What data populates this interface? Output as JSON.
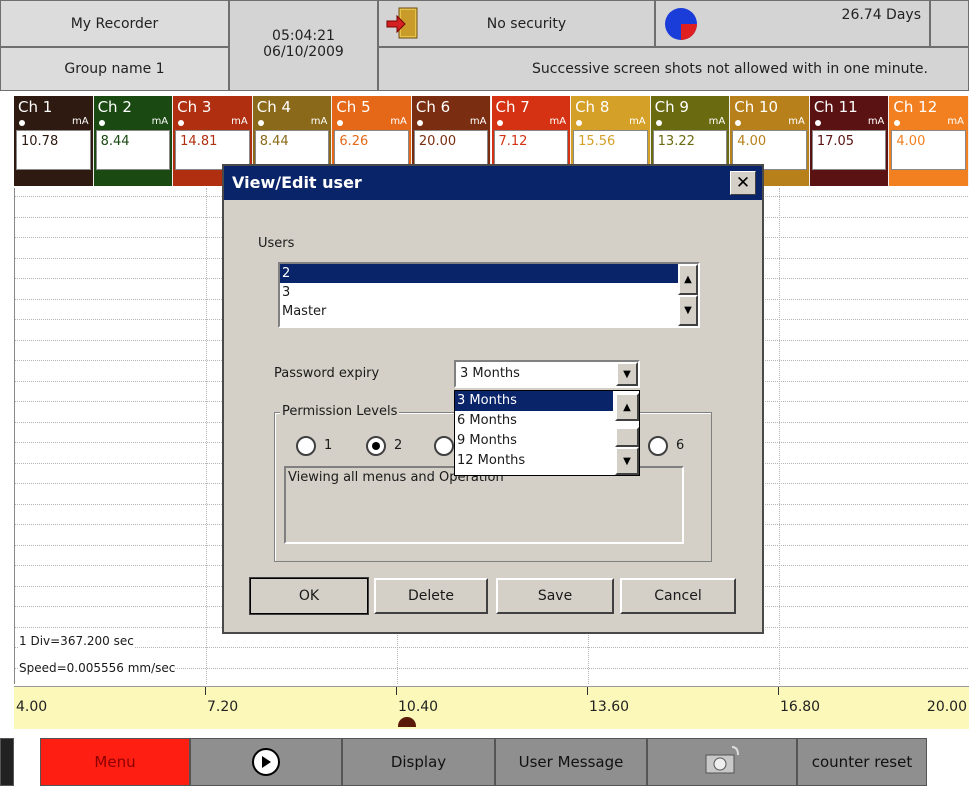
{
  "header": {
    "recorder_name": "My Recorder",
    "group_name": "Group name 1",
    "time": "05:04:21",
    "date": "06/10/2009",
    "security": "No security",
    "days": "26.74 Days",
    "status_message": "Successive screen shots not allowed with in one minute."
  },
  "channels": [
    {
      "name": "Ch 1",
      "unit": "mA",
      "value": "10.78",
      "color": "#2e1a10"
    },
    {
      "name": "Ch 2",
      "unit": "mA",
      "value": "8.44",
      "color": "#1a4a12"
    },
    {
      "name": "Ch 3",
      "unit": "mA",
      "value": "14.81",
      "color": "#b02f10"
    },
    {
      "name": "Ch 4",
      "unit": "mA",
      "value": "8.44",
      "color": "#8a6a1a"
    },
    {
      "name": "Ch 5",
      "unit": "mA",
      "value": "6.26",
      "color": "#e56818"
    },
    {
      "name": "Ch 6",
      "unit": "mA",
      "value": "20.00",
      "color": "#7a2d10"
    },
    {
      "name": "Ch 7",
      "unit": "mA",
      "value": "7.12",
      "color": "#d43212"
    },
    {
      "name": "Ch 8",
      "unit": "mA",
      "value": "15.56",
      "color": "#d4a028"
    },
    {
      "name": "Ch 9",
      "unit": "mA",
      "value": "13.22",
      "color": "#6a6a10"
    },
    {
      "name": "Ch 10",
      "unit": "mA",
      "value": "4.00",
      "color": "#b8801a"
    },
    {
      "name": "Ch 11",
      "unit": "mA",
      "value": "17.05",
      "color": "#5a1212"
    },
    {
      "name": "Ch 12",
      "unit": "mA",
      "value": "4.00",
      "color": "#f28020"
    }
  ],
  "chart": {
    "division": "1 Div=367.200 sec",
    "speed": "Speed=0.005556 mm/sec",
    "scale": [
      "4.00",
      "7.20",
      "10.40",
      "13.60",
      "16.80",
      "20.00"
    ]
  },
  "toolbar": {
    "menu": "Menu",
    "display": "Display",
    "user_message": "User Message",
    "counter_reset": "counter reset"
  },
  "dialog": {
    "title": "View/Edit user",
    "close": "✕",
    "users_label": "Users",
    "users": [
      "2",
      "3",
      "Master"
    ],
    "selected_user": "2",
    "password_expiry_label": "Password expiry",
    "password_expiry_value": "3 Months",
    "expiry_options": [
      "3 Months",
      "6 Months",
      "9 Months",
      "12 Months"
    ],
    "permission_label": "Permission Levels",
    "levels": [
      "1",
      "2",
      "6"
    ],
    "selected_level": "2",
    "description": "Viewing all menus and Operation",
    "buttons": {
      "ok": "OK",
      "delete": "Delete",
      "save": "Save",
      "cancel": "Cancel"
    }
  },
  "colors": {
    "title_bar": "#0a246a",
    "menu_button": "#ff1e12",
    "scale_band": "#fbf8b9"
  }
}
